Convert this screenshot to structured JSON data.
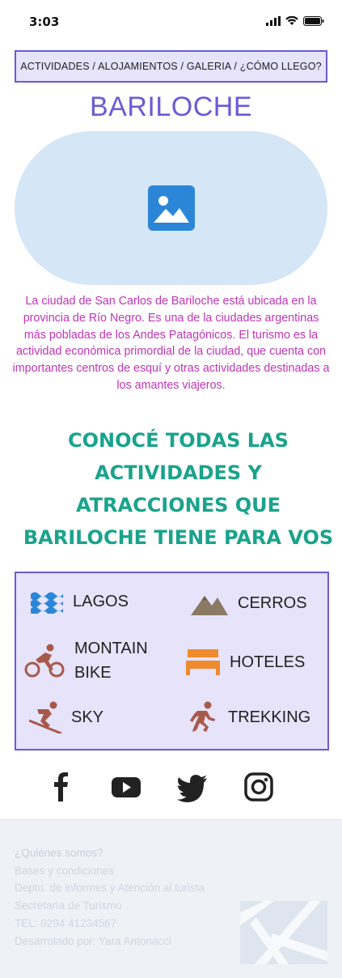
{
  "status_bar": {
    "time": "3:03"
  },
  "nav": {
    "text": "ACTIVIDADES / ALOJAMIENTOS / GALERIA / ¿CÓMO LLEGO?"
  },
  "title": "BARILOCHE",
  "description": "La ciudad de San Carlos de Bariloche está ubicada en la provincia de Río Negro. Es una de la ciudades argentinas más pobladas de los Andes Patagónicos. El turismo es la actividad económica primordial de la ciudad, que cuenta con importantes centros de esquí y otras actividades destinadas a los amantes viajeros.",
  "cta": {
    "line1": "CONOCÉ  TODAS LAS",
    "line2": "ACTIVIDADES Y",
    "line3": "ATRACCIONES QUE",
    "line4": "BARILOCHE TIENE PARA VOS"
  },
  "activities": {
    "lagos": "LAGOS",
    "cerros": "CERROS",
    "montain_line1": "MONTAIN",
    "montain_line2": "BIKE",
    "hoteles": "HOTELES",
    "sky": "SKY",
    "trekking": "TREKKING"
  },
  "icons": {
    "image": "image-icon",
    "lagos": "water-waves-icon",
    "cerros": "mountain-icon",
    "bike": "biker-icon",
    "hoteles": "bed-icon",
    "sky": "skier-icon",
    "trekking": "runner-icon",
    "social": [
      "facebook-icon",
      "youtube-icon",
      "twitter-icon",
      "instagram-icon"
    ]
  },
  "footer": {
    "links": [
      "¿Quiénes somos?",
      "Bases y condiciones",
      "Depto. de informes y Atención al turista",
      "Secretaría de Turismo",
      "TEL: 0294 41234567",
      "Desarrolado por: Yara Antonacci"
    ]
  },
  "colors": {
    "accent_purple": "#6a5bd6",
    "box_bg": "#e6e3fb",
    "description_magenta": "#c034b6",
    "cta_teal": "#1aa38c",
    "image_blue": "#2b86d8",
    "activity_icon_red": "#a85a4a",
    "mountain_brown": "#8a7a64",
    "bed_orange": "#ef8a2e"
  }
}
